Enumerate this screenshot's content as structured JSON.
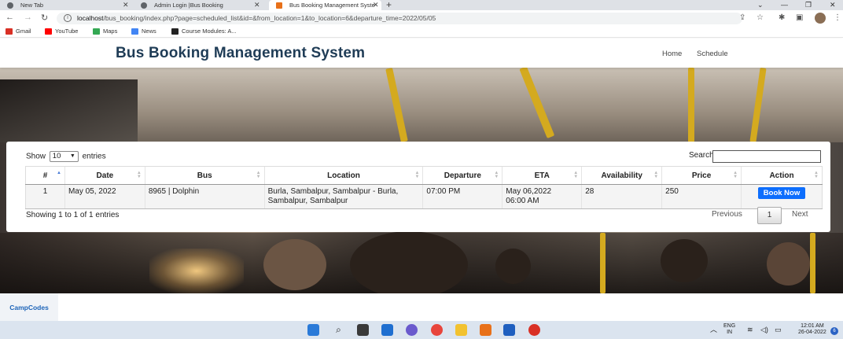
{
  "browser": {
    "tabs": [
      {
        "title": "New Tab"
      },
      {
        "title": "Admin Login |Bus Booking"
      },
      {
        "title": "Bus Booking Management Syste"
      }
    ],
    "url_host": "localhost",
    "url_path": "/bus_booking/index.php?page=scheduled_list&id=&from_location=1&to_location=6&departure_time=2022/05/05",
    "bookmarks": [
      {
        "label": "Gmail",
        "color": "#d93025"
      },
      {
        "label": "YouTube",
        "color": "#ff0000"
      },
      {
        "label": "Maps",
        "color": "#34a853"
      },
      {
        "label": "News",
        "color": "#4285f4"
      },
      {
        "label": "Course Modules: A...",
        "color": "#222222"
      }
    ]
  },
  "site": {
    "brand": "Bus Booking Management System",
    "nav": [
      "Home",
      "Schedule"
    ],
    "brand_color": "#1f3c56"
  },
  "table_controls": {
    "show_label": "Show",
    "page_length": "10",
    "entries_label": "entries",
    "search_label": "Search:",
    "search_value": ""
  },
  "table": {
    "columns": [
      "#",
      "Date",
      "Bus",
      "Location",
      "Departure",
      "ETA",
      "Availability",
      "Price",
      "Action"
    ],
    "rows": [
      {
        "num": "1",
        "date": "May 05, 2022",
        "bus": "8965 | Dolphin",
        "location": "Burla, Sambalpur, Sambalpur - Burla, Sambalpur, Sambalpur",
        "departure": "07:00 PM",
        "eta": "May 06,2022 06:00 AM",
        "availability": "28",
        "price": "250",
        "action": "Book Now"
      }
    ],
    "info": "Showing 1 to 1 of 1 entries",
    "pagination": {
      "previous": "Previous",
      "current": "1",
      "next": "Next"
    },
    "action_color": "#0d6efd"
  },
  "footer": {
    "brand": "CampCodes"
  },
  "taskbar": {
    "lang_top": "ENG",
    "lang_bottom": "IN",
    "time": "12:01 AM",
    "date": "26-04-2022",
    "notifications": "6"
  }
}
